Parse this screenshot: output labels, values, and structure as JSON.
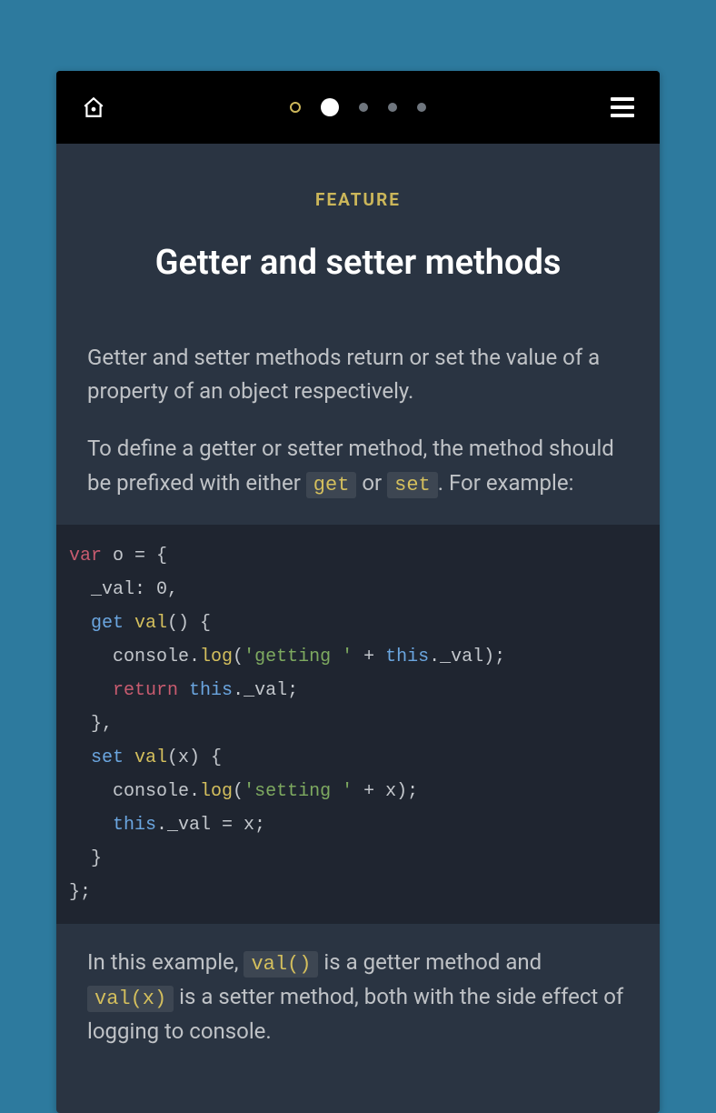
{
  "nav": {
    "home_label": "home",
    "menu_label": "menu",
    "page_count": 5,
    "active_index": 1
  },
  "eyebrow": "FEATURE",
  "title": "Getter and setter methods",
  "para1": "Getter and setter methods return or set the value of a property of an object respectively.",
  "para2_a": "To define a getter or setter method, the method should be prefixed with either ",
  "para2_kw1": "get",
  "para2_mid": " or ",
  "para2_kw2": "set",
  "para2_b": ". For example:",
  "code": {
    "l1_var": "var",
    "l1_rest": " o = {",
    "l2": "  _val: 0,",
    "l3_get": "  get",
    "l3_name": " val",
    "l3_rest": "() {",
    "l4_a": "    console.",
    "l4_log": "log",
    "l4_b": "(",
    "l4_str": "'getting '",
    "l4_c": " + ",
    "l4_this": "this",
    "l4_d": "._val);",
    "l5_a": "    ",
    "l5_ret": "return",
    "l5_b": " ",
    "l5_this": "this",
    "l5_c": "._val;",
    "l6": "  },",
    "l7_set": "  set",
    "l7_name": " val",
    "l7_rest": "(x) {",
    "l8_a": "    console.",
    "l8_log": "log",
    "l8_b": "(",
    "l8_str": "'setting '",
    "l8_c": " + x);",
    "l9_a": "    ",
    "l9_this": "this",
    "l9_b": "._val = x;",
    "l10": "  }",
    "l11": "};"
  },
  "para3_a": "In this example, ",
  "para3_kw1": "val()",
  "para3_b": " is a getter method and ",
  "para3_kw2": "val(x)",
  "para3_c": " is a setter method, both with the side effect of logging to console."
}
